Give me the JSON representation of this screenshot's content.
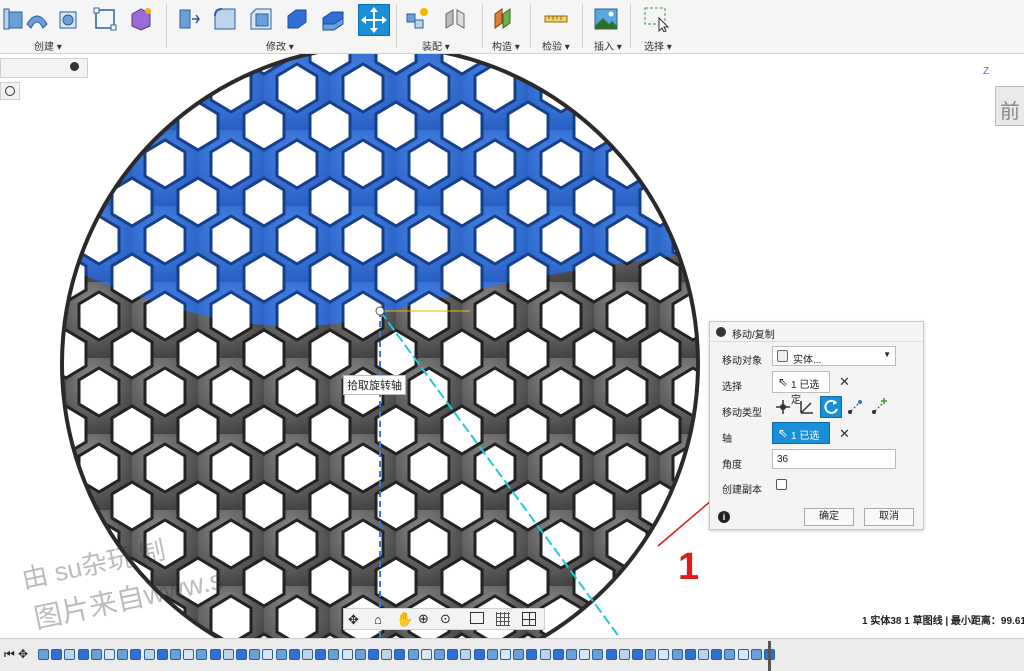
{
  "toolbar": {
    "groups": [
      {
        "label": "创建 ▾"
      },
      {
        "label": "修改 ▾"
      },
      {
        "label": "装配 ▾"
      },
      {
        "label": "构造 ▾"
      },
      {
        "label": "检验 ▾"
      },
      {
        "label": "插入 ▾"
      },
      {
        "label": "选择 ▾"
      }
    ]
  },
  "viewcube": {
    "face": "前",
    "axis": "Z"
  },
  "tooltip": "拾取旋转轴",
  "panel": {
    "title": "移动/复制",
    "move_object_label": "移动对象",
    "move_object_value": "实体...",
    "select_label": "选择",
    "select_value": "1 已选定",
    "move_type_label": "移动类型",
    "axis_label": "轴",
    "axis_value": "1 已选定",
    "angle_label": "角度",
    "angle_value": "36",
    "create_copy_label": "创建副本",
    "ok": "确定",
    "cancel": "取消",
    "info": "i"
  },
  "status": "1 实体38 1 草图线 | 最小距离：99.61",
  "annotation": "1",
  "watermark": {
    "line1": "由 su杂玩 制",
    "line2": "图片来自www.s"
  },
  "colors": {
    "accent": "#1a8fd6",
    "blue_body": "#2f6fd8",
    "gray_body": "#4a4a4a",
    "annotation": "#e0191e"
  }
}
